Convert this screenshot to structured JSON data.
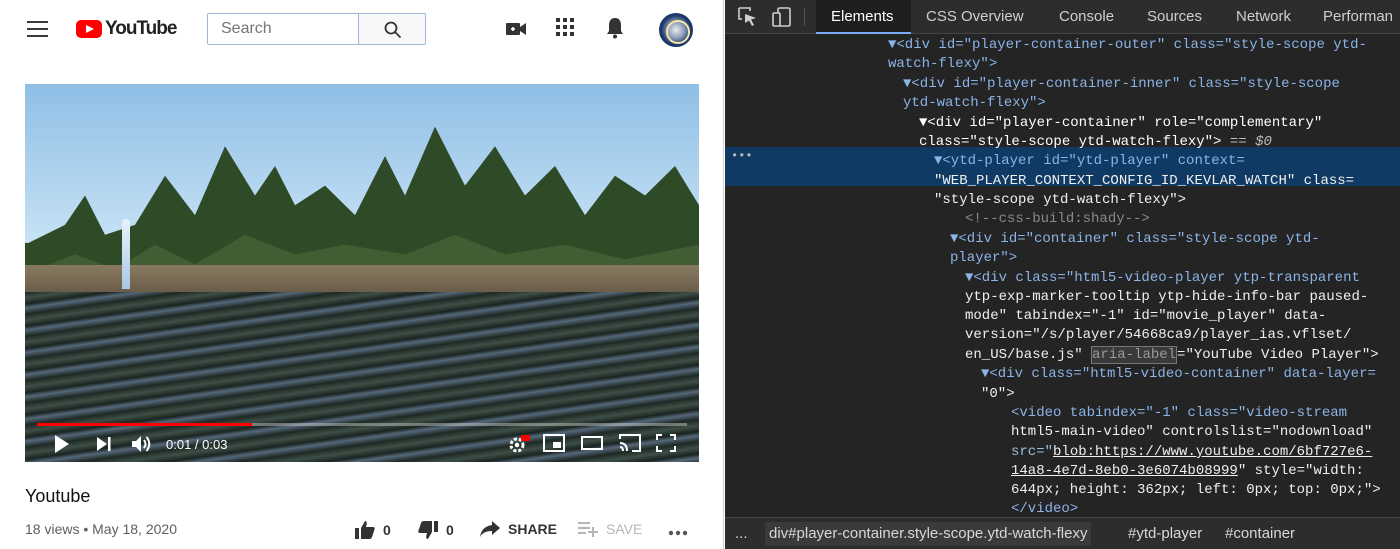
{
  "youtube": {
    "logo_text": "YouTube",
    "search": {
      "placeholder": "Search"
    },
    "icons": [
      "menu-icon",
      "search-icon",
      "create-video-icon",
      "apps-grid-icon",
      "notifications-bell-icon",
      "avatar"
    ],
    "player": {
      "time": "0:01 / 0:03",
      "progress_fraction": 0.33,
      "progress_color": "#ff0000"
    },
    "video_title": "Youtube",
    "meta": "18 views • May 18, 2020",
    "actions": {
      "like_count": "0",
      "dislike_count": "0",
      "share_label": "SHARE",
      "save_label": "SAVE"
    }
  },
  "devtools": {
    "tabs": [
      "Elements",
      "CSS Overview",
      "Console",
      "Sources",
      "Network",
      "Performan"
    ],
    "active_tab": "Elements",
    "selection_color": "#0f3a63",
    "dom": {
      "l1": "<div id=\"player-container-outer\" class=\"style-scope ytd-",
      "l1b": "watch-flexy\">",
      "l2": "<div id=\"player-container-inner\" class=\"style-scope",
      "l2b": "ytd-watch-flexy\">",
      "l3": "<div id=\"player-container\" role=\"complementary\"",
      "l3b": "class=\"style-scope ytd-watch-flexy\">",
      "l3eq": "== $0",
      "l4": "<ytd-player id=\"ytd-player\" context=",
      "l4b": "\"WEB_PLAYER_CONTEXT_CONFIG_ID_KEVLAR_WATCH\" class=",
      "l4c": "\"style-scope ytd-watch-flexy\">",
      "l5": "<!--css-build:shady-->",
      "l6": "<div id=\"container\" class=\"style-scope ytd-",
      "l6b": "player\">",
      "l7": "<div class=\"html5-video-player ytp-transparent",
      "l7b": "ytp-exp-marker-tooltip ytp-hide-info-bar paused-",
      "l7c": "mode\" tabindex=\"-1\" id=\"movie_player\" data-",
      "l7d": "version=\"/s/player/54668ca9/player_ias.vflset/",
      "l7e_pre": "en_US/base.js\" ",
      "l7e_hl": "aria-label",
      "l7e_post": "=\"YouTube Video Player\">",
      "l8": "<div class=\"html5-video-container\" data-layer=",
      "l8b": "\"0\">",
      "l9": "<video tabindex=\"-1\" class=\"video-stream",
      "l9b": "html5-main-video\" controlslist=\"nodownload\"",
      "l9c_pre": "src=\"",
      "l9c_link": "blob:https://www.youtube.com/6bf727e6-",
      "l9d_link": "14a8-4e7d-8eb0-3e6074b08999",
      "l9d_post": "\" style=\"width:",
      "l9e": "644px; height: 362px; left: 0px; top: 0px;\">",
      "l9f": "</video>"
    },
    "breadcrumbs": [
      "div#player-container.style-scope.ytd-watch-flexy",
      "#ytd-player",
      "#container"
    ]
  }
}
